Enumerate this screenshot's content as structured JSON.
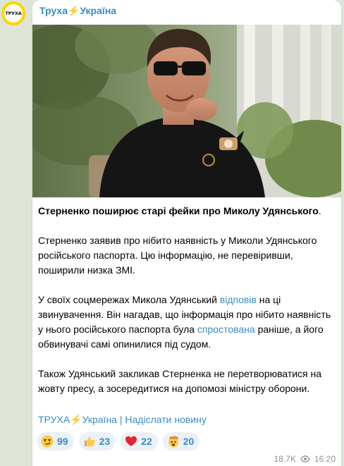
{
  "channel": {
    "avatar_text": "ТРУХА",
    "name_part1": "Труха",
    "bolt": "⚡",
    "name_part2": "Україна"
  },
  "post": {
    "photo_icon": "photo-of-man-in-sunglasses",
    "headline": "Стерненко поширює старі фейки про Миколу Удянського",
    "headline_end": ".",
    "p1": "Стерненко заявив про нібито наявність у Миколи Удянського російського паспорта. Цю інформацію, не перевіривши, поширили низка ЗМІ.",
    "p2_a": "У своїх соцмережах Микола Удянський ",
    "p2_link1": "відповів",
    "p2_b": " на ці звинувачення. Він нагадав, що інформація про нібито наявність у нього російського паспорта була ",
    "p2_link2": "спростована",
    "p2_c": " раніше, а його обвинувачі самі опинилися під судом.",
    "p3": "Також Удянський закликав Стерненка не перетворюватися на жовту пресу, а зосередитися на допомозі міністру оборони."
  },
  "footer": {
    "channel_link_a": "ТРУХА",
    "channel_link_bolt": "⚡",
    "channel_link_b": "Україна",
    "separator": " | ",
    "submit_link": "Надіслати новину"
  },
  "reactions": [
    {
      "icon": "smirk-emoji",
      "count": "99"
    },
    {
      "icon": "thumbs-up-emoji",
      "count": "23"
    },
    {
      "icon": "red-heart-emoji",
      "count": "22"
    },
    {
      "icon": "exploding-head-emoji",
      "count": "20"
    }
  ],
  "meta": {
    "views": "18.7K",
    "views_icon": "eye-icon",
    "time": "16:20"
  },
  "colors": {
    "link": "#3a8bc5",
    "bolt": "#f6b600",
    "avatar": "#ffd400",
    "chat_background": "#dfe5d6"
  }
}
